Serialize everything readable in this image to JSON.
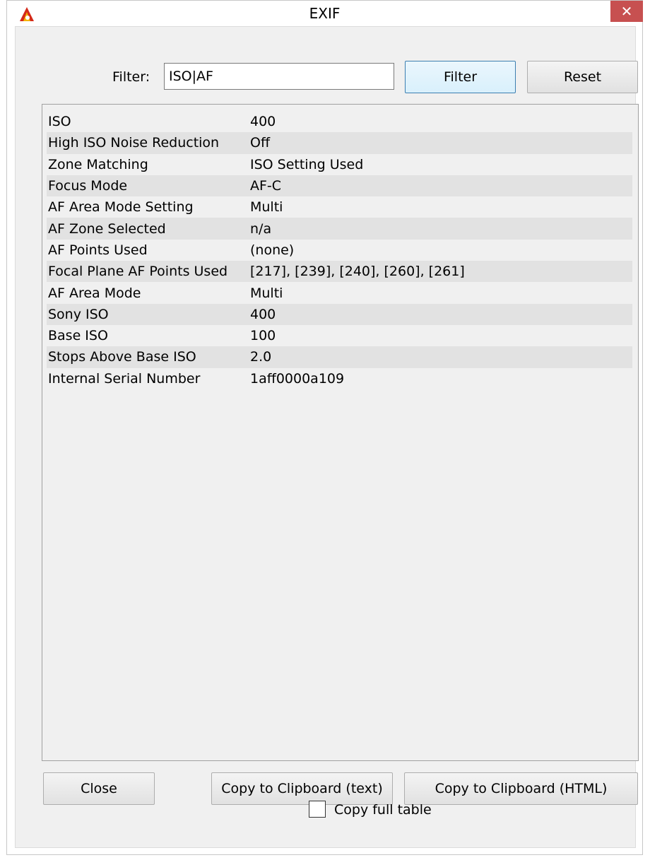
{
  "window": {
    "title": "EXIF",
    "close_glyph": "✕"
  },
  "filter": {
    "label": "Filter:",
    "value": "ISO|AF",
    "filter_button": "Filter",
    "reset_button": "Reset"
  },
  "table": {
    "rows": [
      {
        "key": "ISO",
        "value": "400"
      },
      {
        "key": "High ISO Noise Reduction",
        "value": "Off"
      },
      {
        "key": "Zone Matching",
        "value": "ISO Setting Used"
      },
      {
        "key": "Focus Mode",
        "value": "AF-C"
      },
      {
        "key": "AF Area Mode Setting",
        "value": "Multi"
      },
      {
        "key": "AF Zone Selected",
        "value": "n/a"
      },
      {
        "key": "AF Points Used",
        "value": "(none)"
      },
      {
        "key": "Focal Plane AF Points Used",
        "value": "[217], [239], [240], [260], [261]"
      },
      {
        "key": "AF Area Mode",
        "value": "Multi"
      },
      {
        "key": "Sony ISO",
        "value": "400"
      },
      {
        "key": "Base ISO",
        "value": "100"
      },
      {
        "key": "Stops Above Base ISO",
        "value": "2.0"
      },
      {
        "key": "Internal Serial Number",
        "value": "1aff0000a109"
      }
    ]
  },
  "footer": {
    "close_button": "Close",
    "copy_text_button": "Copy to Clipboard (text)",
    "copy_html_button": "Copy to Clipboard (HTML)",
    "copy_full_table_label": "Copy full table",
    "copy_full_table_checked": false
  },
  "colors": {
    "close_button_bg": "#c75050",
    "focused_button_border": "#3c7fb1",
    "alt_row_bg": "#e2e2e2"
  }
}
